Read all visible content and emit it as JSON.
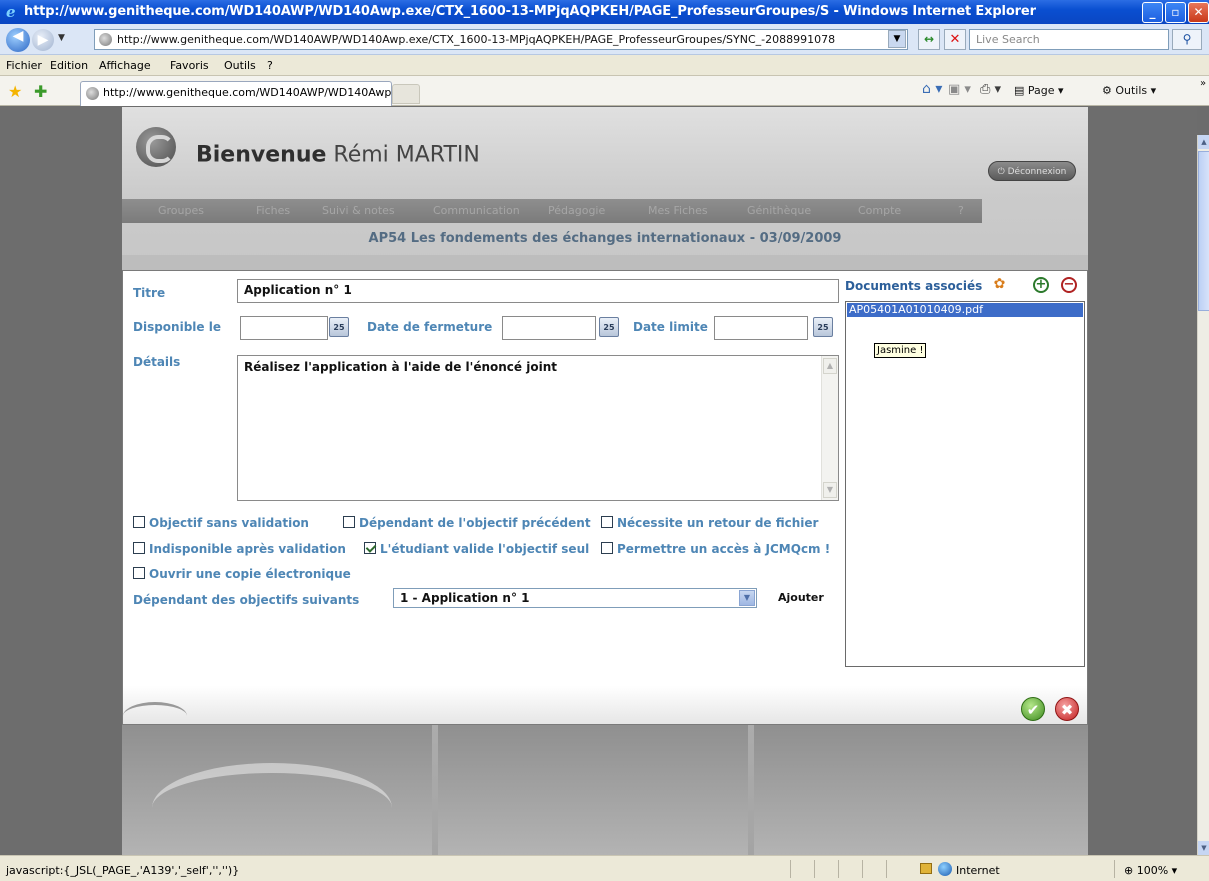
{
  "browser": {
    "title": "http://www.genitheque.com/WD140AWP/WD140Awp.exe/CTX_1600-13-MPjqAQPKEH/PAGE_ProfesseurGroupes/S - Windows Internet Explorer",
    "url": "http://www.genitheque.com/WD140AWP/WD140Awp.exe/CTX_1600-13-MPjqAQPKEH/PAGE_ProfesseurGroupes/SYNC_-2088991078",
    "search_placeholder": "Live Search",
    "menu": [
      "Fichier",
      "Edition",
      "Affichage",
      "Favoris",
      "Outils",
      "?"
    ],
    "tab_title": "http://www.genitheque.com/WD140AWP/WD140Awp...",
    "commands": {
      "page": "Page",
      "tools": "Outils"
    },
    "status_text": "javascript:{_JSL(_PAGE_,'A139','_self','','')}",
    "zone": "Internet",
    "zoom": "100%"
  },
  "site": {
    "welcome_bold": "Bienvenue",
    "welcome_name": "Rémi MARTIN",
    "logout_label": "Déconnexion",
    "nav": [
      "Groupes",
      "Fiches",
      "Suivi & notes",
      "Communication",
      "Pédagogie",
      "Mes Fiches",
      "Génithèque",
      "Compte",
      "?"
    ],
    "course_title": "AP54 Les fondements des échanges internationaux - 03/09/2009"
  },
  "dialog": {
    "title_label": "Titre",
    "title_value": "Application n° 1",
    "available_label": "Disponible le",
    "available_value": "",
    "close_date_label": "Date de fermeture",
    "close_date_value": "",
    "deadline_label": "Date limite",
    "deadline_value": "",
    "details_label": "Détails",
    "details_value": "Réalisez l'application à l'aide de l'énoncé joint",
    "options": [
      {
        "label": "Objectif sans validation",
        "checked": false
      },
      {
        "label": "Dépendant de l'objectif précédent",
        "checked": false
      },
      {
        "label": "Nécessite un retour de fichier",
        "checked": false
      },
      {
        "label": "Indisponible après validation",
        "checked": false
      },
      {
        "label": "L'étudiant valide l'objectif seul",
        "checked": true
      },
      {
        "label": "Permettre un accès à JCMQcm !",
        "checked": false
      },
      {
        "label": "Ouvrir une copie électronique",
        "checked": false
      }
    ],
    "depends_label": "Dépendant des objectifs suivants",
    "depends_value": "1 - Application n° 1",
    "add_label": "Ajouter",
    "docs_label": "Documents associés",
    "documents": [
      "AP05401A01010409.pdf"
    ],
    "tooltip": "Jasmine !",
    "calendar_glyph": "25"
  },
  "icons": {
    "back": "back-arrow-icon",
    "forward": "forward-arrow-icon",
    "refresh": "refresh-icon",
    "stop": "stop-icon",
    "search": "search-icon",
    "favorites": "favorites-star-icon",
    "add_favorite": "add-favorite-icon",
    "home": "home-icon",
    "feeds": "rss-feed-icon",
    "print": "print-icon",
    "ok": "checkmark-icon",
    "cancel": "cancel-icon"
  },
  "colors": {
    "label_blue": "#4e86b5",
    "selection": "#3d6cc8",
    "course_title": "#546c83"
  }
}
